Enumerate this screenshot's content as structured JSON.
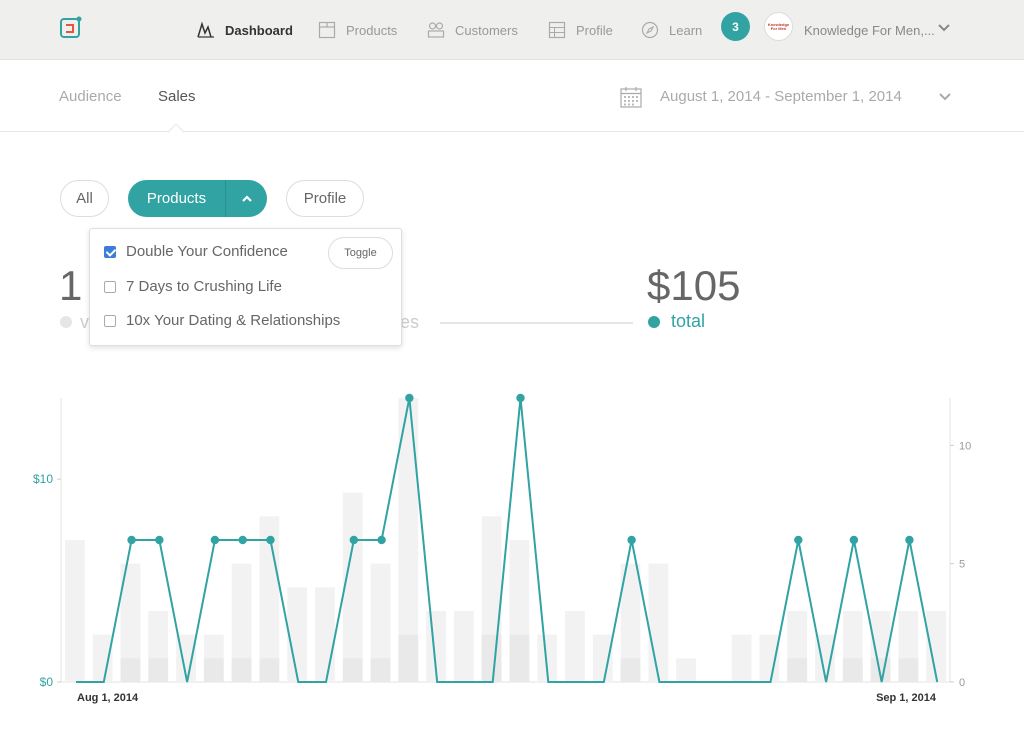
{
  "nav": {
    "items": [
      {
        "label": "Dashboard",
        "icon": "dashboard-icon",
        "active": true
      },
      {
        "label": "Products",
        "icon": "box-icon",
        "active": false
      },
      {
        "label": "Customers",
        "icon": "users-icon",
        "active": false
      },
      {
        "label": "Profile",
        "icon": "profile-icon",
        "active": false
      },
      {
        "label": "Learn",
        "icon": "compass-icon",
        "active": false
      }
    ],
    "badge": "3",
    "account_name": "Knowledge For Men,...",
    "avatar_lines": [
      "Knowledge",
      "For Men"
    ]
  },
  "subnav": {
    "tabs": [
      {
        "label": "Audience",
        "active": false
      },
      {
        "label": "Sales",
        "active": true
      }
    ],
    "date_range": "August 1, 2014 - September 1, 2014"
  },
  "filters": {
    "all_label": "All",
    "products_label": "Products",
    "profile_label": "Profile"
  },
  "dropdown": {
    "toggle_label": "Toggle",
    "items": [
      {
        "label": "Double Your Confidence",
        "checked": true
      },
      {
        "label": "7 Days to Crushing Life",
        "checked": false
      },
      {
        "label": "10x Your Dating & Relationships",
        "checked": false
      }
    ]
  },
  "stats": {
    "left_value_partial": "1",
    "left_label_partial": "v",
    "mid_label_partial": "es",
    "total_value": "$105",
    "total_label": "total"
  },
  "colors": {
    "accent": "#31a3a3",
    "bar": "#f2f2f2",
    "bar_inner": "#e9e9e9"
  },
  "chart_data": {
    "type": "bar",
    "left_axis": {
      "ticks": [
        "$0",
        "$10"
      ],
      "tick_values": [
        0,
        10
      ],
      "range": [
        0,
        14
      ]
    },
    "right_axis": {
      "ticks": [
        "0",
        "5",
        "10"
      ],
      "tick_values": [
        0,
        5,
        10
      ],
      "range": [
        0,
        12
      ]
    },
    "x_labels": [
      "Aug 1, 2014",
      "Sep 1, 2014"
    ],
    "bars": [
      6,
      2,
      5,
      3,
      2,
      2,
      5,
      7,
      4,
      4,
      8,
      5,
      12,
      3,
      3,
      7,
      6,
      2,
      3,
      2,
      5,
      5,
      1,
      0,
      2,
      2,
      3,
      2,
      3,
      3,
      3,
      3
    ],
    "bars_inner": [
      0,
      0,
      1,
      1,
      0,
      1,
      1,
      1,
      0,
      0,
      1,
      1,
      2,
      0,
      0,
      2,
      2,
      0,
      0,
      0,
      1,
      0,
      0,
      0,
      0,
      0,
      1,
      0,
      1,
      1,
      1,
      0
    ],
    "line": [
      0,
      0,
      6,
      6,
      0,
      6,
      6,
      6,
      0,
      0,
      6,
      6,
      12,
      0,
      0,
      0,
      12,
      0,
      0,
      0,
      6,
      0,
      0,
      0,
      0,
      0,
      6,
      0,
      6,
      0,
      6,
      0
    ],
    "line_x_start": 1
  }
}
